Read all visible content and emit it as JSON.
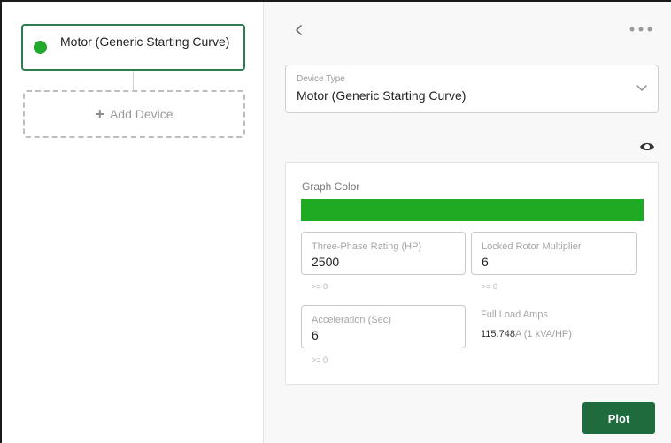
{
  "tree": {
    "device_label": "Motor (Generic Starting Curve)",
    "device_color": "#22a82b",
    "add_device_label": "Add Device",
    "add_icon": "plus-icon"
  },
  "header": {
    "back_icon": "chevron-left-icon",
    "more_icon": "more-horizontal-icon"
  },
  "device_type": {
    "label": "Device Type",
    "value": "Motor (Generic Starting Curve)"
  },
  "visibility_icon": "eye-icon",
  "settings": {
    "graph_color_label": "Graph Color",
    "graph_color": "#1faa24",
    "three_phase_rating": {
      "label": "Three-Phase Rating (HP)",
      "value": "2500",
      "hint": ">= 0"
    },
    "locked_rotor_multiplier": {
      "label": "Locked Rotor Multiplier",
      "value": "6",
      "hint": ">= 0"
    },
    "acceleration": {
      "label": "Acceleration (Sec)",
      "value": "6",
      "hint": ">= 0"
    },
    "full_load_amps": {
      "label": "Full Load Amps",
      "value": "115.748",
      "unit": "A (1 kVA/HP)"
    }
  },
  "actions": {
    "plot_label": "Plot"
  }
}
